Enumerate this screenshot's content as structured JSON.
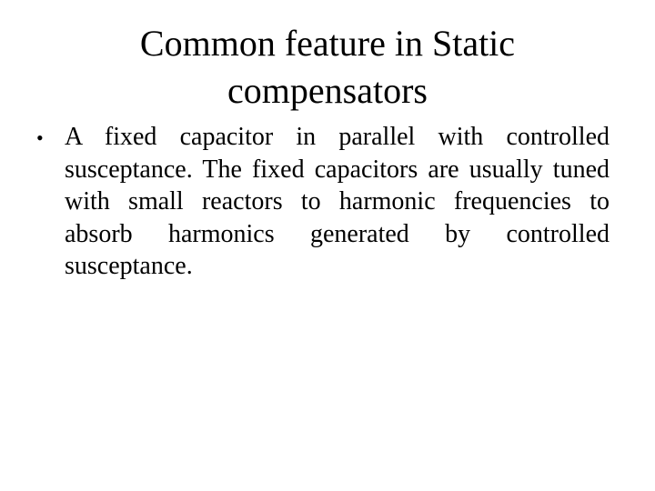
{
  "slide": {
    "title": "Common feature in Static compensators",
    "bullets": [
      {
        "marker": "•",
        "text": "A fixed capacitor in parallel with controlled susceptance. The fixed capacitors  are usually tuned with small reactors to  harmonic frequencies to absorb harmonics generated by controlled susceptance."
      }
    ]
  }
}
